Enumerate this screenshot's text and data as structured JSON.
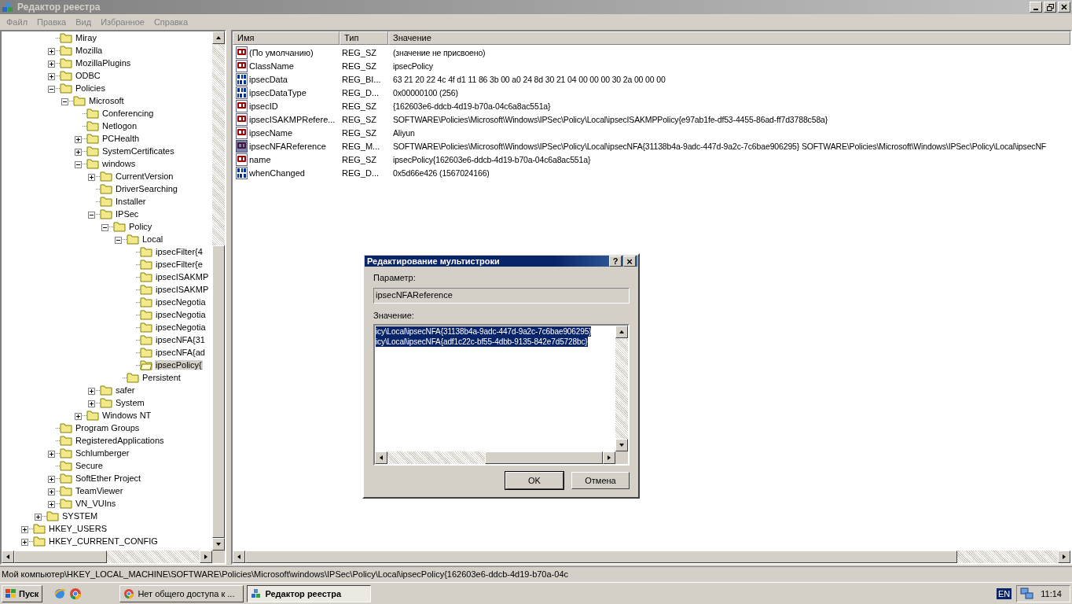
{
  "window": {
    "title": "Редактор реестра",
    "active": false
  },
  "menu": [
    "Файл",
    "Правка",
    "Вид",
    "Избранное",
    "Справка"
  ],
  "tree": {
    "items": [
      {
        "children": [
          {
            "children": [
              {
                "children": [
                  {
                    "label": "Miray",
                    "selected": false
                  },
                  {
                    "label": "Mozilla",
                    "expanded": false,
                    "selected": false
                  },
                  {
                    "label": "MozillaPlugins",
                    "expanded": false,
                    "selected": false
                  },
                  {
                    "label": "ODBC",
                    "expanded": false,
                    "selected": false
                  },
                  {
                    "label": "Policies",
                    "expanded": true,
                    "selected": false,
                    "children": [
                      {
                        "label": "Microsoft",
                        "expanded": true,
                        "selected": false,
                        "children": [
                          {
                            "label": "Conferencing",
                            "selected": false
                          },
                          {
                            "label": "Netlogon",
                            "selected": false
                          },
                          {
                            "label": "PCHealth",
                            "expanded": false,
                            "selected": false
                          },
                          {
                            "label": "SystemCertificates",
                            "expanded": false,
                            "selected": false
                          },
                          {
                            "label": "windows",
                            "expanded": true,
                            "selected": false,
                            "children": [
                              {
                                "label": "CurrentVersion",
                                "expanded": false,
                                "selected": false
                              },
                              {
                                "label": "DriverSearching",
                                "selected": false
                              },
                              {
                                "label": "Installer",
                                "selected": false
                              },
                              {
                                "label": "IPSec",
                                "expanded": true,
                                "selected": false,
                                "children": [
                                  {
                                    "label": "Policy",
                                    "expanded": true,
                                    "selected": false,
                                    "children": [
                                      {
                                        "label": "Local",
                                        "expanded": true,
                                        "selected": false,
                                        "children": [
                                          {
                                            "label": "ipsecFilter{4",
                                            "selected": false
                                          },
                                          {
                                            "label": "ipsecFilter{e",
                                            "selected": false
                                          },
                                          {
                                            "label": "ipsecISAKMP",
                                            "selected": false
                                          },
                                          {
                                            "label": "ipsecISAKMP",
                                            "selected": false
                                          },
                                          {
                                            "label": "ipsecNegotia",
                                            "selected": false
                                          },
                                          {
                                            "label": "ipsecNegotia",
                                            "selected": false
                                          },
                                          {
                                            "label": "ipsecNegotia",
                                            "selected": false
                                          },
                                          {
                                            "label": "ipsecNFA{31",
                                            "selected": false
                                          },
                                          {
                                            "label": "ipsecNFA{ad",
                                            "selected": false
                                          },
                                          {
                                            "label": "ipsecPolicy{",
                                            "selected": true
                                          }
                                        ]
                                      },
                                      {
                                        "label": "Persistent",
                                        "selected": false
                                      }
                                    ]
                                  }
                                ]
                              },
                              {
                                "label": "safer",
                                "expanded": false,
                                "selected": false
                              },
                              {
                                "label": "System",
                                "expanded": false,
                                "selected": false
                              }
                            ]
                          },
                          {
                            "label": "Windows NT",
                            "expanded": false,
                            "selected": false
                          }
                        ]
                      }
                    ]
                  },
                  {
                    "label": "Program Groups",
                    "selected": false
                  },
                  {
                    "label": "RegisteredApplications",
                    "selected": false
                  },
                  {
                    "label": "Schlumberger",
                    "expanded": false,
                    "selected": false
                  },
                  {
                    "label": "Secure",
                    "selected": false
                  },
                  {
                    "label": "SoftEther Project",
                    "expanded": false,
                    "selected": false
                  },
                  {
                    "label": "TeamViewer",
                    "expanded": false,
                    "selected": false
                  },
                  {
                    "label": "VN_VUIns",
                    "expanded": false,
                    "selected": false
                  }
                ]
              },
              {
                "label": "SYSTEM",
                "expanded": false,
                "selected": false
              }
            ]
          },
          {
            "label": "HKEY_USERS",
            "expanded": false,
            "selected": false
          },
          {
            "label": "HKEY_CURRENT_CONFIG",
            "expanded": false,
            "selected": false
          }
        ]
      }
    ]
  },
  "values": {
    "columns": [
      "Имя",
      "Тип",
      "Значение"
    ],
    "rows": [
      {
        "kind": "string",
        "name": "(По умолчанию)",
        "type": "REG_SZ",
        "data": "(значение не присвоено)",
        "selected": false
      },
      {
        "kind": "string",
        "name": "ClassName",
        "type": "REG_SZ",
        "data": "ipsecPolicy",
        "selected": false
      },
      {
        "kind": "binary",
        "name": "ipsecData",
        "type": "REG_BI...",
        "data": "63 21 20 22 4c 4f d1 11 86 3b 00 a0 24 8d 30 21 04 00 00 00 30 2a 00 00 00",
        "selected": false
      },
      {
        "kind": "binary",
        "name": "ipsecDataType",
        "type": "REG_D...",
        "data": "0x00000100 (256)",
        "selected": false
      },
      {
        "kind": "string",
        "name": "ipsecID",
        "type": "REG_SZ",
        "data": "{162603e6-ddcb-4d19-b70a-04c6a8ac551a}",
        "selected": false
      },
      {
        "kind": "string",
        "name": "ipsecISAKMPRefere...",
        "type": "REG_SZ",
        "data": "SOFTWARE\\Policies\\Microsoft\\Windows\\IPSec\\Policy\\Local\\ipsecISAKMPPolicy{e97ab1fe-df53-4455-86ad-ff7d3788c58a}",
        "selected": false
      },
      {
        "kind": "string",
        "name": "ipsecName",
        "type": "REG_SZ",
        "data": "Aliyun",
        "selected": false
      },
      {
        "kind": "string",
        "name": "ipsecNFAReference",
        "type": "REG_M...",
        "data": "SOFTWARE\\Policies\\Microsoft\\Windows\\IPSec\\Policy\\Local\\ipsecNFA{31138b4a-9adc-447d-9a2c-7c6bae906295} SOFTWARE\\Policies\\Microsoft\\Windows\\IPSec\\Policy\\Local\\ipsecNF",
        "selected": true
      },
      {
        "kind": "string",
        "name": "name",
        "type": "REG_SZ",
        "data": "ipsecPolicy{162603e6-ddcb-4d19-b70a-04c6a8ac551a}",
        "selected": false
      },
      {
        "kind": "binary",
        "name": "whenChanged",
        "type": "REG_D...",
        "data": "0x5d66e426 (1567024166)",
        "selected": false
      }
    ]
  },
  "status_bar": "Мой компьютер\\HKEY_LOCAL_MACHINE\\SOFTWARE\\Policies\\Microsoft\\windows\\IPSec\\Policy\\Local\\ipsecPolicy{162603e6-ddcb-4d19-b70a-04c",
  "dialog": {
    "title": "Редактирование мультистроки",
    "help": "?",
    "close": "×",
    "name_label": "Параметр:",
    "name_value": "ipsecNFAReference",
    "value_label": "Значение:",
    "value": {
      "lines": [
        "icy\\Local\\ipsecNFA{31138b4a-9adc-447d-9a2c-7c6bae906295}",
        "icy\\Local\\ipsecNFA{adf1c22c-bf55-4dbb-9135-842e7d5728bc}"
      ],
      "selected": true
    },
    "buttons": [
      {
        "label": "OK",
        "default": true
      },
      {
        "label": "Отмена",
        "default": false
      }
    ]
  },
  "taskbar": {
    "start": "Пуск",
    "tasks": [
      {
        "label": "Нет общего доступа к ...",
        "kind": "browser",
        "selected": false
      },
      {
        "label": "Редактор реестра",
        "kind": "regedit",
        "selected": true
      }
    ],
    "language": "EN",
    "clock": "11:14"
  }
}
